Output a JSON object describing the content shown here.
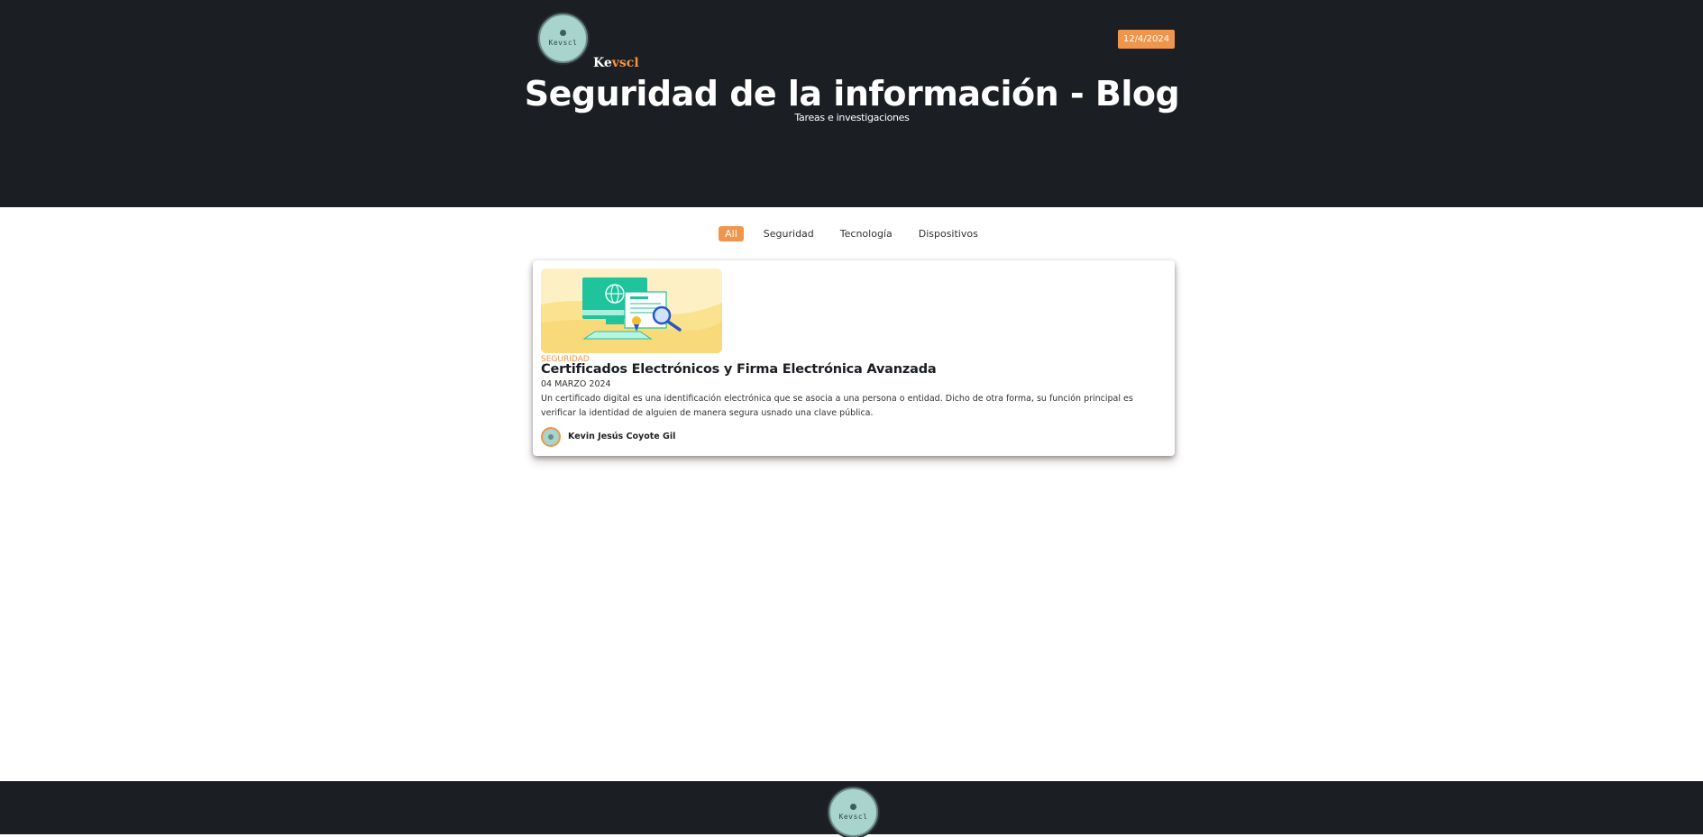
{
  "header": {
    "logo_text": "Kevscl",
    "brand": {
      "part1": "Ke",
      "part2": "vscl"
    },
    "date": "12/4/2024",
    "title": "Seguridad de la información - Blog",
    "subtitle": "Tareas e investigaciones"
  },
  "filters": [
    {
      "label": "All",
      "active": true
    },
    {
      "label": "Seguridad",
      "active": false
    },
    {
      "label": "Tecnología",
      "active": false
    },
    {
      "label": "Dispositivos",
      "active": false
    }
  ],
  "post": {
    "category": "SEGURIDAD",
    "title": "Certificados Electrónicos y Firma Electrónica Avanzada",
    "date": "04 MARZO 2024",
    "excerpt": "Un certificado digital es una identificación electrónica que se asocia a una persona o entidad. Dicho de otra forma, su función principal es verificar la identidad de alguien de manera segura usnado una clave pública.",
    "author": "Kevin Jesús Coyote Gil",
    "thumbnail_icon": "certificate-computer-illustration"
  },
  "footer": {
    "logo_text": "Kevscl"
  },
  "colors": {
    "accent": "#f0954c",
    "dark": "#1b1e22",
    "logo_bg": "#a9d3cd"
  }
}
